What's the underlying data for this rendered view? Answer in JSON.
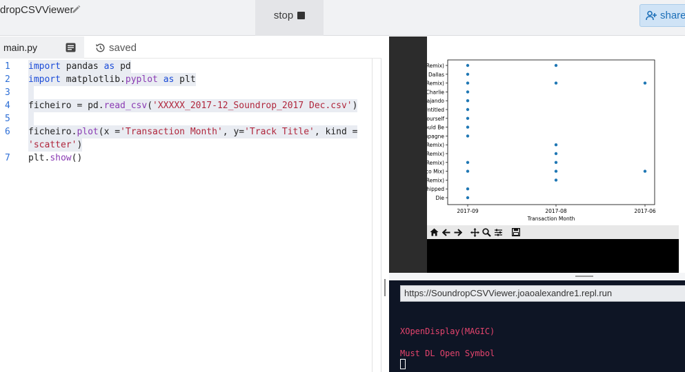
{
  "topbar": {
    "project_title": "dropCSVViewer",
    "stop_label": "stop",
    "share_label": "share"
  },
  "editor": {
    "file_name": "main.py",
    "saved_label": "saved",
    "line_numbers": [
      "1",
      "2",
      "3",
      "4",
      "5",
      "6",
      "",
      "7"
    ]
  },
  "console": {
    "url": "https://SoundropCSVViewer.joaoalexandre1.repl.run",
    "line1": "XOpenDisplay(MAGIC)",
    "line2": "Must DL Open Symbol"
  },
  "chart_data": {
    "type": "scatter",
    "xlabel": "Transaction Month",
    "ylabel": "",
    "x_categories": [
      "2017-09",
      "2017-08",
      "2017-06"
    ],
    "y_categories": [
      "os (Remix)",
      "Dallas",
      "o (Remix)",
      "Charlie",
      "Viajando",
      "Untitled",
      "zz Yourself",
      "Could Be",
      "hampagne",
      "rk Remix)",
      "rk Remix)",
      "rk Remix)",
      "Disco Mix)",
      "me Remix)",
      "Whipped",
      "Die"
    ],
    "points": [
      {
        "x": "2017-09",
        "y": "os (Remix)"
      },
      {
        "x": "2017-08",
        "y": "os (Remix)"
      },
      {
        "x": "2017-09",
        "y": "Dallas"
      },
      {
        "x": "2017-09",
        "y": "o (Remix)"
      },
      {
        "x": "2017-08",
        "y": "o (Remix)"
      },
      {
        "x": "2017-06",
        "y": "o (Remix)"
      },
      {
        "x": "2017-09",
        "y": "Charlie"
      },
      {
        "x": "2017-09",
        "y": "Viajando"
      },
      {
        "x": "2017-09",
        "y": "Untitled"
      },
      {
        "x": "2017-09",
        "y": "zz Yourself"
      },
      {
        "x": "2017-09",
        "y": "Could Be"
      },
      {
        "x": "2017-09",
        "y": "hampagne"
      },
      {
        "x": "2017-08",
        "y": "rk Remix)#9"
      },
      {
        "x": "2017-08",
        "y": "rk Remix)#10"
      },
      {
        "x": "2017-09",
        "y": "rk Remix)#11"
      },
      {
        "x": "2017-08",
        "y": "rk Remix)#11"
      },
      {
        "x": "2017-09",
        "y": "Disco Mix)"
      },
      {
        "x": "2017-08",
        "y": "Disco Mix)"
      },
      {
        "x": "2017-06",
        "y": "Disco Mix)"
      },
      {
        "x": "2017-08",
        "y": "me Remix)"
      },
      {
        "x": "2017-09",
        "y": "Whipped"
      },
      {
        "x": "2017-09",
        "y": "Die"
      }
    ],
    "marker_color": "#1f77b4",
    "grid": false
  }
}
